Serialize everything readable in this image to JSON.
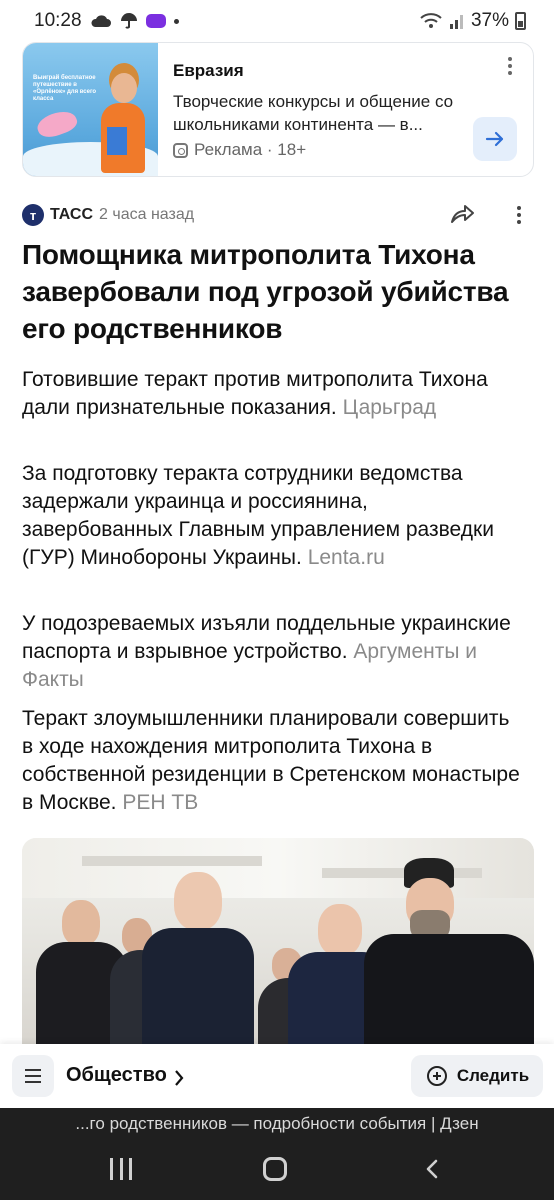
{
  "status_bar": {
    "time": "10:28",
    "battery": "37%"
  },
  "ad": {
    "image_text": "Выиграй бесплатное путешествие в «Орлёнок» для всего класса",
    "title": "Евразия",
    "description": "Творческие конкурсы и общение со школьниками континента — в...",
    "label": "Реклама · 18+"
  },
  "article": {
    "source_logo": "т",
    "source": "ТАСС",
    "time": "2 часа назад",
    "headline": "Помощника митрополита Тихона завербовали под угрозой убийства его родственников",
    "paragraphs": [
      {
        "text": "Готовившие теракт против митрополита Тихона дали признательные показания.",
        "source": "Царьград"
      },
      {
        "text": "За подготовку теракта сотрудники ведомства задержали украинца и россиянина, завербованных Главным управлением разведки (ГУР) Минобороны Украины.",
        "source": "Lenta.ru"
      },
      {
        "text": "У подозреваемых изъяли поддельные украинские паспорта и взрывное устройство.",
        "source": "Аргументы и Факты"
      },
      {
        "text": "Теракт злоумышленники планировали совершить в ходе нахождения митрополита Тихона в собственной резиденции в Сретенском монастыре в Москве.",
        "source": "РЕН ТВ"
      }
    ]
  },
  "bottom_bar": {
    "category": "Общество",
    "follow_label": "Следить"
  },
  "tab_title": "...го родственников — подробности события | Дзен",
  "colors": {
    "accent_button_bg": "#e4eefb",
    "accent_arrow": "#2f6fd6",
    "source_logo_bg": "#1e2f6b",
    "nav_bg": "#1f1f1f"
  },
  "icons": [
    "cloud-icon",
    "umbrella-icon",
    "wifi-icon",
    "signal-icon",
    "battery-icon",
    "share-icon",
    "more-icon",
    "arrow-right-icon",
    "menu-icon",
    "chevron-right-icon",
    "follow-icon",
    "recent-apps-icon",
    "home-icon",
    "back-icon"
  ]
}
